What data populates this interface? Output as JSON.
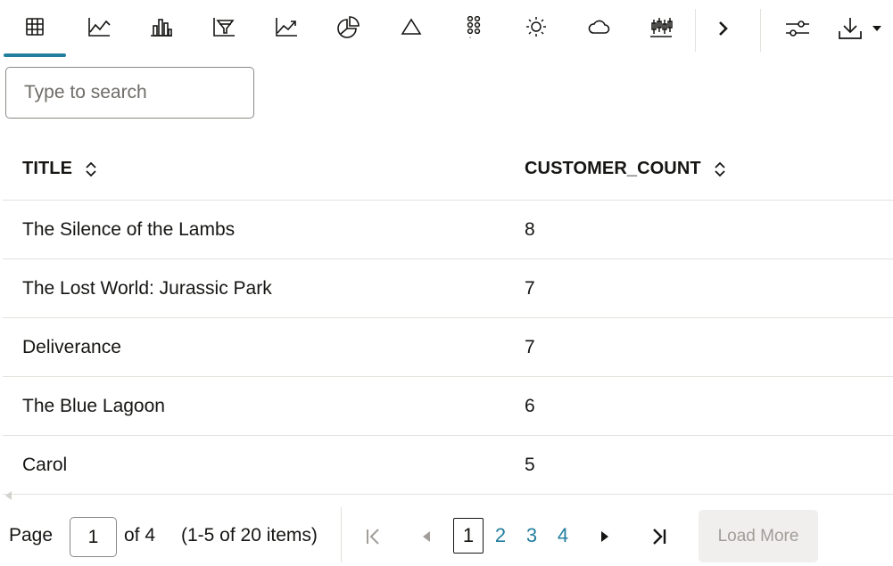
{
  "toolbar": {
    "views": [
      {
        "name": "table-icon",
        "active": true
      },
      {
        "name": "line-chart-icon"
      },
      {
        "name": "bar-chart-icon"
      },
      {
        "name": "funnel-chart-icon"
      },
      {
        "name": "area-chart-icon"
      },
      {
        "name": "pie-chart-icon"
      },
      {
        "name": "pyramid-chart-icon"
      },
      {
        "name": "bubble-chart-icon"
      },
      {
        "name": "sunburst-chart-icon"
      },
      {
        "name": "tag-cloud-icon"
      },
      {
        "name": "stock-chart-icon"
      }
    ],
    "more_icon": "chevron-right-icon",
    "settings_icon": "settings-sliders-icon",
    "download_icon": "download-icon",
    "accent": "#227e9e"
  },
  "search": {
    "placeholder": "Type to search",
    "value": ""
  },
  "table": {
    "columns": [
      "TITLE",
      "CUSTOMER_COUNT"
    ],
    "rows": [
      {
        "title": "The Silence of the Lambs",
        "count": "8"
      },
      {
        "title": "The Lost World: Jurassic Park",
        "count": "7"
      },
      {
        "title": "Deliverance",
        "count": "7"
      },
      {
        "title": "The Blue Lagoon",
        "count": "6"
      },
      {
        "title": "Carol",
        "count": "5"
      }
    ]
  },
  "pagination": {
    "page_label": "Page",
    "page_value": "1",
    "of_label": "of 4",
    "items_label": "(1-5 of 20 items)",
    "pages": [
      "1",
      "2",
      "3",
      "4"
    ],
    "load_more": "Load More"
  }
}
